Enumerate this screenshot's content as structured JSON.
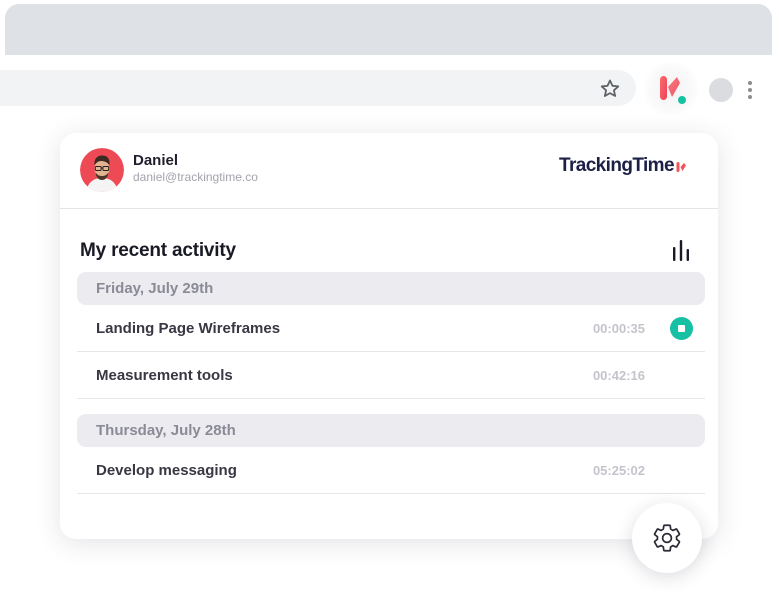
{
  "browser": {
    "toolbar": {
      "bookmark_icon": "star-icon",
      "extension_icon": "trackingtime-icon",
      "profile_icon": "profile-circle-icon",
      "menu_icon": "kebab-menu-icon"
    }
  },
  "popup": {
    "user": {
      "name": "Daniel",
      "email": "daniel@trackingtime.co"
    },
    "brand": {
      "name": "TrackingTime"
    },
    "section_title": "My recent activity",
    "days": [
      {
        "label": "Friday, July 29th",
        "entries": [
          {
            "title": "Landing Page Wireframes",
            "time": "00:00:35",
            "running": true
          },
          {
            "title": "Measurement tools",
            "time": "00:42:16",
            "running": false
          }
        ]
      },
      {
        "label": "Thursday, July 28th",
        "entries": [
          {
            "title": "Develop messaging",
            "time": "05:25:02",
            "running": false
          }
        ]
      }
    ]
  },
  "colors": {
    "accent_teal": "#15c0a3",
    "brand_coral": "#f2545b",
    "brand_navy": "#1d1f47"
  }
}
